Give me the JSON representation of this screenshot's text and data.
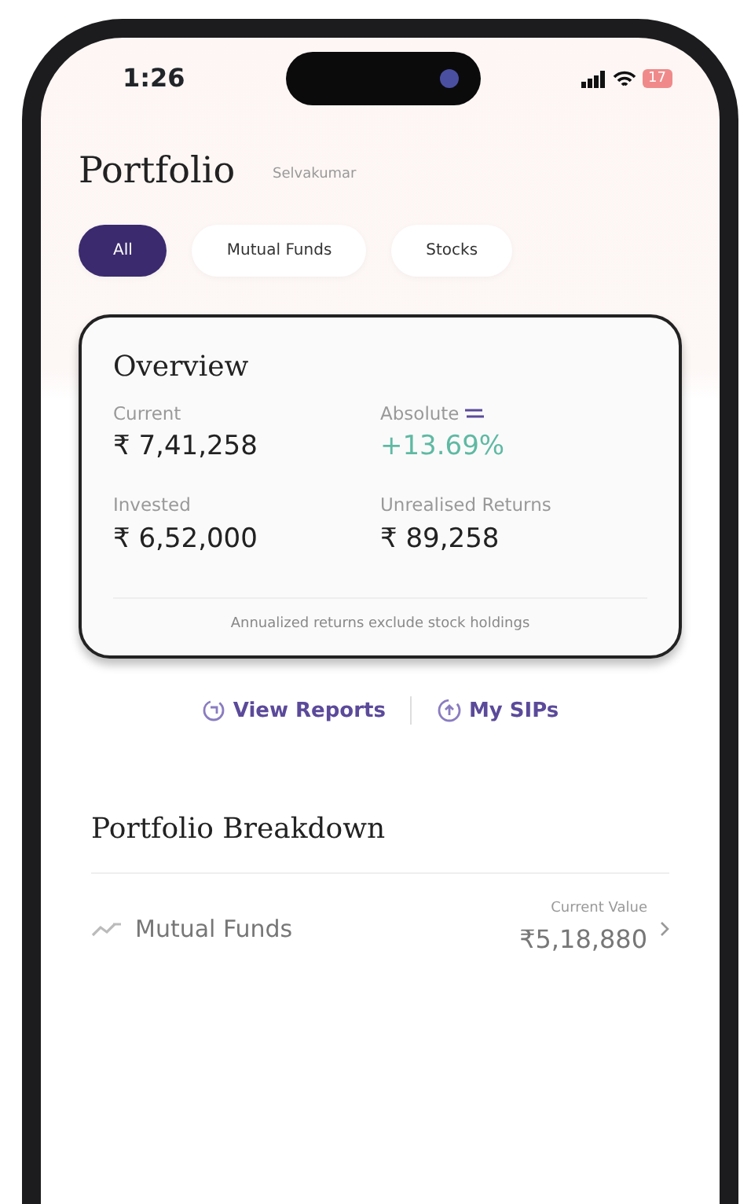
{
  "status_bar": {
    "time": "1:26",
    "battery": "17"
  },
  "header": {
    "title": "Portfolio",
    "subtitle": "Selvakumar"
  },
  "filters": [
    {
      "label": "All",
      "selected": true
    },
    {
      "label": "Mutual Funds",
      "selected": false
    },
    {
      "label": "Stocks",
      "selected": false
    }
  ],
  "overview": {
    "title": "Overview",
    "metrics": [
      {
        "label": "Current",
        "value": "₹ 7,41,258",
        "kind": "plain",
        "switchable": false
      },
      {
        "label": "Absolute",
        "value": "+13.69%",
        "kind": "gain",
        "switchable": true
      },
      {
        "label": "Invested",
        "value": "₹ 6,52,000",
        "kind": "plain",
        "switchable": false
      },
      {
        "label": "Unrealised Returns",
        "value": "₹ 89,258",
        "kind": "plain",
        "switchable": false
      }
    ],
    "note": "Annualized returns exclude stock holdings"
  },
  "links": [
    {
      "label": "View Reports",
      "kind": "reports"
    },
    {
      "label": "My SIPs",
      "kind": "sips"
    }
  ],
  "breakdown": {
    "title": "Portfolio Breakdown",
    "rows": [
      {
        "name": "Mutual Funds",
        "value_label": "Current Value",
        "value": "₹5,18,880"
      }
    ]
  }
}
